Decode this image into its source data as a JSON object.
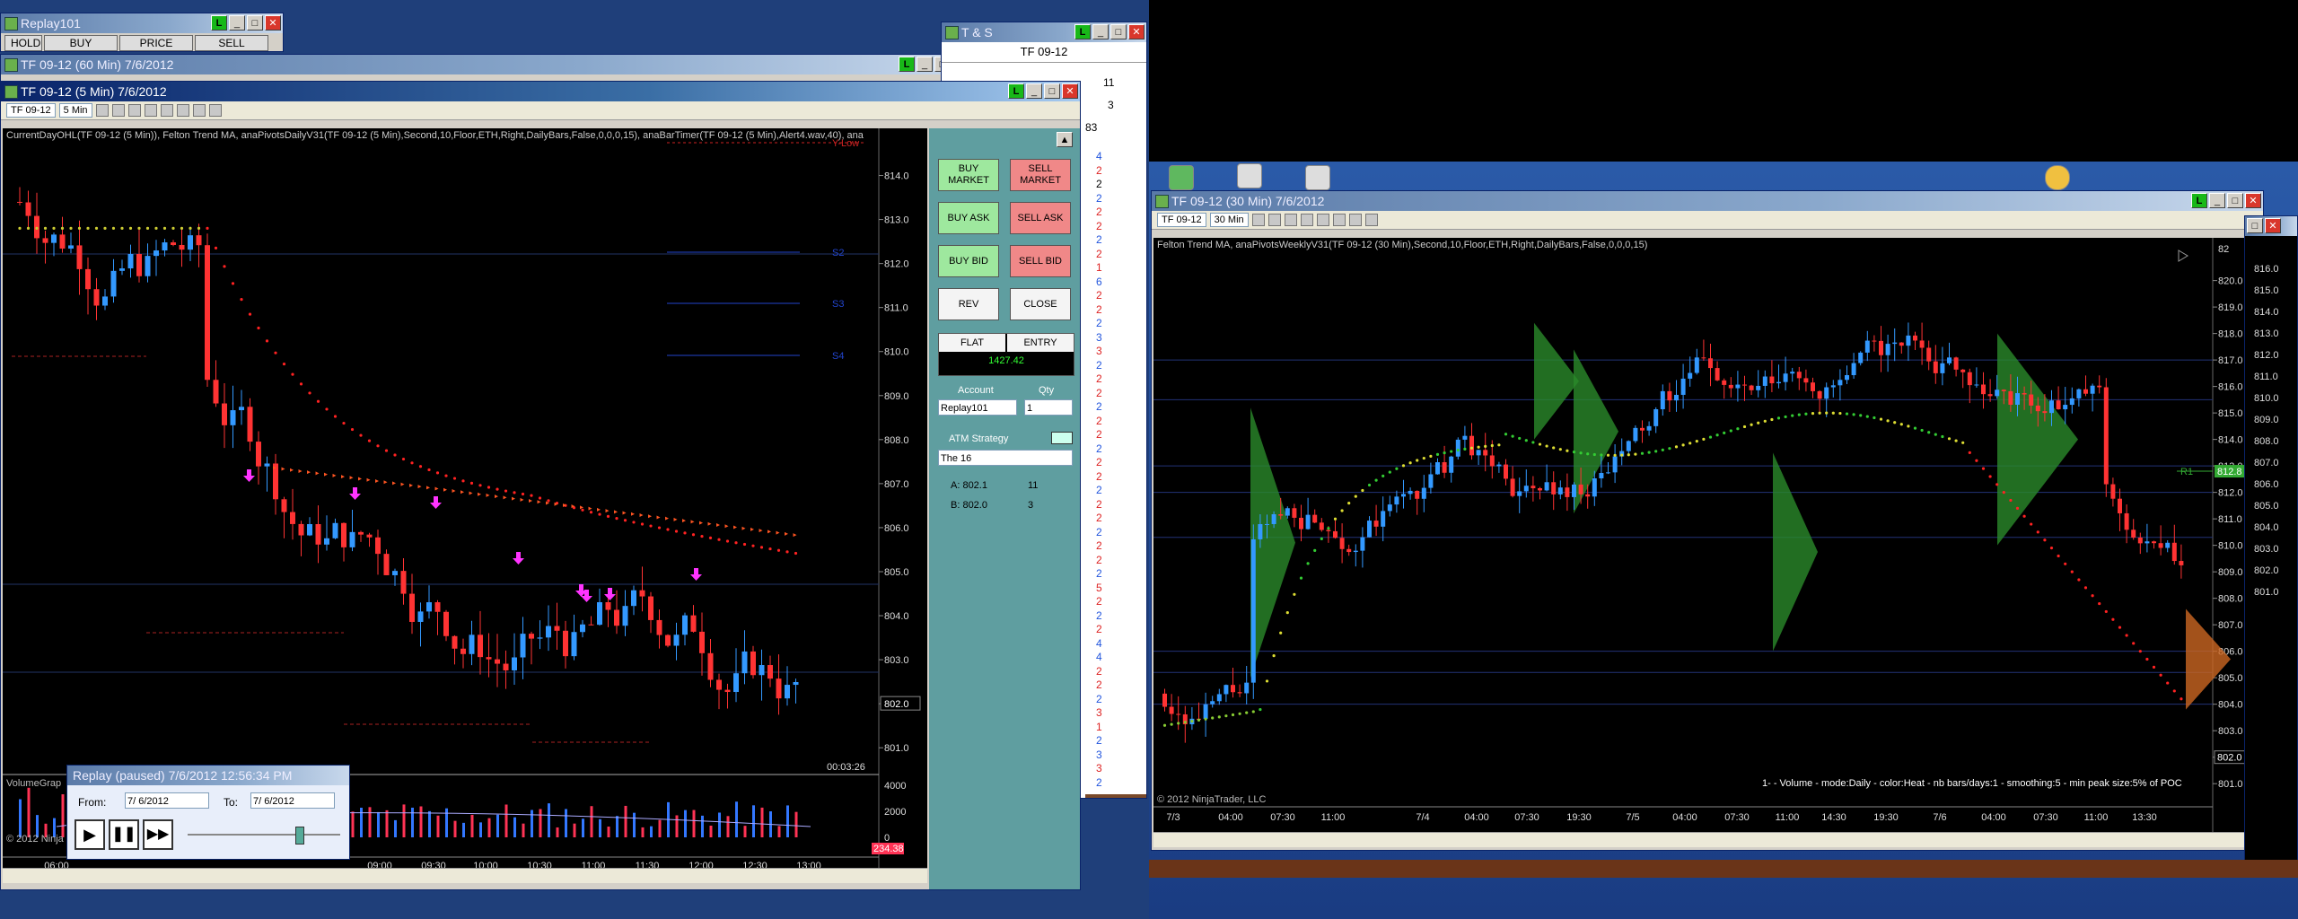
{
  "top_left_window": {
    "title": "Replay101",
    "buttons": [
      "HOLD",
      "BUY",
      "PRICE",
      "SELL"
    ]
  },
  "win_60": {
    "title": "TF 09-12 (60 Min)  7/6/2012"
  },
  "win_5": {
    "title": "TF 09-12 (5 Min)  7/6/2012",
    "instrument": "TF 09-12",
    "interval": "5 Min",
    "indicator_label": "CurrentDayOHL(TF 09-12 (5 Min)), Felton Trend MA, anaPivotsDailyV31(TF 09-12 (5 Min),Second,10,Floor,ETH,Right,DailyBars,False,0,0,0,15), anaBarTimer(TF 09-12 (5 Min),Alert4.wav,40), ana",
    "ylow_label": "Y-Low",
    "pivots": [
      "S2",
      "S3",
      "S4"
    ],
    "price_ticks": [
      "814.0",
      "813.0",
      "812.0",
      "811.0",
      "810.0",
      "809.0",
      "808.0",
      "807.0",
      "806.0",
      "805.0",
      "804.0",
      "803.0",
      "802.0",
      "801.0"
    ],
    "last_price": "802.0",
    "bar_timer": "00:03:26",
    "volume_label": "VolumeGrap",
    "volume_ticks": [
      "4000",
      "2000",
      "0"
    ],
    "volume_badge": "234.38",
    "time_ticks": [
      "06:00",
      "09:00",
      "09:30",
      "10:00",
      "10:30",
      "11:00",
      "11:30",
      "12:00",
      "12:30",
      "13:00"
    ],
    "copyright": "© 2012 Ninja"
  },
  "replay_window": {
    "title": "Replay (paused) 7/6/2012 12:56:34 PM",
    "from_label": "From:",
    "from_value": "7/ 6/2012",
    "to_label": "To:",
    "to_value": "7/ 6/2012"
  },
  "order_panel": {
    "buy_market": "BUY MARKET",
    "sell_market": "SELL MARKET",
    "buy_ask": "BUY ASK",
    "sell_ask": "SELL ASK",
    "buy_bid": "BUY BID",
    "sell_bid": "SELL BID",
    "rev": "REV",
    "close": "CLOSE",
    "flat": "FLAT",
    "entry": "ENTRY",
    "pnl": "1427.42",
    "account_label": "Account",
    "qty_label": "Qty",
    "account_value": "Replay101",
    "qty_value": "1",
    "atm_label": "ATM Strategy",
    "atm_value": "The 16",
    "ask_label": "A: 802.1",
    "ask_size": "11",
    "bid_label": "B: 802.0",
    "bid_size": "3"
  },
  "tns": {
    "title": "T & S",
    "instrument": "TF 09-12",
    "header_rows": [
      "11",
      "3",
      "83"
    ],
    "sizes": [
      "4",
      "2",
      "2",
      "2",
      "2",
      "2",
      "2",
      "2",
      "1",
      "6",
      "2",
      "2",
      "2",
      "3",
      "3",
      "2",
      "2",
      "2",
      "2",
      "2",
      "2",
      "2",
      "2",
      "2",
      "2",
      "2",
      "2",
      "2",
      "2",
      "2",
      "2",
      "5",
      "2",
      "2",
      "2",
      "4",
      "4",
      "2",
      "2",
      "2",
      "3",
      "1",
      "2",
      "3",
      "3",
      "2"
    ]
  },
  "win_30": {
    "title": "TF 09-12 (30 Min)  7/6/2012",
    "instrument": "TF 09-12",
    "interval": "30 Min",
    "indicator_label": "Felton Trend MA, anaPivotsWeeklyV31(TF 09-12 (30 Min),Second,10,Floor,ETH,Right,DailyBars,False,0,0,0,15)",
    "price_ticks": [
      "820.0",
      "819.0",
      "818.0",
      "817.0",
      "816.0",
      "815.0",
      "814.0",
      "813.0",
      "812.0",
      "811.0",
      "810.0",
      "809.0",
      "808.0",
      "807.0",
      "806.0",
      "805.0",
      "804.0",
      "803.0",
      "802.0",
      "801.0"
    ],
    "price_ticks_top": "82",
    "r1_label": "R1",
    "r1_value": "812.8",
    "last_price": "802.0",
    "volume_caption": "1-  - Volume - mode:Daily - color:Heat - nb bars/days:1 - smoothing:5 - min peak size:5% of POC",
    "time_ticks": [
      "7/3",
      "04:00",
      "07:30",
      "11:00",
      "7/4",
      "04:00",
      "07:30",
      "19:30",
      "7/5",
      "04:00",
      "07:30",
      "11:00",
      "14:30",
      "19:30",
      "7/6",
      "04:00",
      "07:30",
      "11:00",
      "13:30"
    ],
    "copyright": "© 2012 NinjaTrader, LLC"
  },
  "right_edge_window": {
    "ticks": [
      "816.0",
      "815.0",
      "814.0",
      "813.0",
      "812.0",
      "811.0",
      "810.0",
      "809.0",
      "808.0",
      "807.0",
      "806.0",
      "805.0",
      "804.0",
      "803.0",
      "802.0",
      "801.0"
    ]
  },
  "colors": {
    "up": "#3399ff",
    "down": "#ff3333",
    "trend_up": "#33cc33",
    "trend_down": "#ff2222",
    "poc_green": "#33aa33"
  }
}
